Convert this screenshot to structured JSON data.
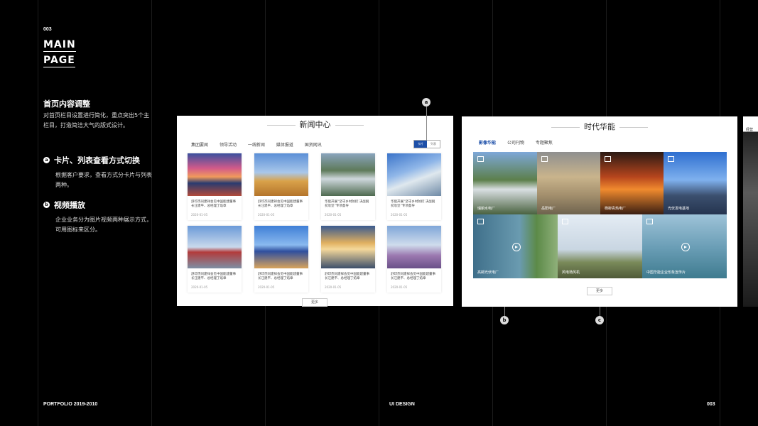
{
  "page_number": "003",
  "title_line1": "MAIN",
  "title_line2": "PAGE",
  "section": {
    "title": "首页内容调整",
    "desc": "对首页栏目设置进行简化，重点突出5个主栏目，打造简洁大气的版式设计。"
  },
  "features": [
    {
      "badge": "a",
      "title": "卡片、列表查看方式切换",
      "desc": "根据客户要求，查看方式分卡片与列表两种。"
    },
    {
      "badge": "b",
      "title": "视频播放",
      "desc": "企业业务分为图片视频两种展示方式，可用图标来区分。"
    }
  ],
  "footer": {
    "left": "PORTFOLIO 2019-2010",
    "center": "UI DESIGN",
    "right": "003"
  },
  "news": {
    "title": "新闻中心",
    "tabs": [
      "集团要闻",
      "领导活动",
      "一线新闻",
      "媒体报道",
      "国资网讯"
    ],
    "toggle": [
      "卡片",
      "列表"
    ],
    "cards": [
      {
        "text": "舒印杰同建祥会见中国能建董事长汪建平、总经理丁焰章",
        "date": "2020-01-05"
      },
      {
        "text": "舒印杰同建祥会见中国能建董事长汪建平、总经理丁焰章",
        "date": "2020-01-05"
      },
      {
        "text": "华能开展“坚守乡村防控 决战脱贫攻坚”专项督导",
        "date": "2020-01-05"
      },
      {
        "text": "华能开展“坚守乡村防控 决战脱贫攻坚”专项督导",
        "date": "2020-01-05"
      },
      {
        "text": "舒印杰同建祥会见中国能建董事长汪建平、总经理丁焰章",
        "date": "2020-01-05"
      },
      {
        "text": "舒印杰同建祥会见中国能建董事长汪建平、总经理丁焰章",
        "date": "2020-01-05"
      },
      {
        "text": "舒印杰同建祥会见中国能建董事长汪建平、总经理丁焰章",
        "date": "2020-01-05"
      },
      {
        "text": "舒印杰同建祥会见中国能建董事长汪建平、总经理丁焰章",
        "date": "2020-01-05"
      }
    ],
    "more": "更多"
  },
  "era": {
    "title": "时代华能",
    "tabs": [
      "影像华能",
      "公司刊物",
      "专题聚焦"
    ],
    "tiles": [
      {
        "caption": "瑞丽水电厂"
      },
      {
        "caption": "岳阳电厂"
      },
      {
        "caption": "杨柳青热电厂"
      },
      {
        "caption": "光伏发电基地"
      },
      {
        "caption": "高邮光伏电厂"
      },
      {
        "caption": "风电场风机"
      },
      {
        "caption": "中国华能企业形象宣传片"
      }
    ],
    "more": "更多"
  },
  "side_panel_text": "经营",
  "markers": [
    "a",
    "b",
    "c"
  ]
}
